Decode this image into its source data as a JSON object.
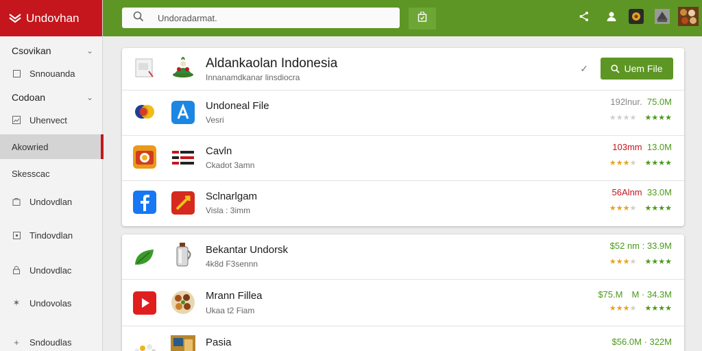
{
  "app": {
    "title": "Undovhan"
  },
  "sidebar": {
    "items": [
      {
        "label": "Csovikan",
        "type": "section"
      },
      {
        "label": "Snnouanda",
        "type": "item",
        "icon": "square-icon"
      },
      {
        "label": "Codoan",
        "type": "section"
      },
      {
        "label": "Uhenvect",
        "type": "item",
        "icon": "chart-icon"
      },
      {
        "label": "Akowried",
        "type": "item",
        "active": true
      },
      {
        "label": "Skesscac",
        "type": "item"
      },
      {
        "label": "Undovdlan",
        "type": "item",
        "icon": "bag-icon"
      },
      {
        "label": "Tindovdlan",
        "type": "item",
        "icon": "square-icon"
      },
      {
        "label": "Undovdlac",
        "type": "item",
        "icon": "lock-icon"
      },
      {
        "label": "Undovolas",
        "type": "item",
        "icon": "star-icon"
      },
      {
        "label": "Sndoudlas",
        "type": "item",
        "icon": "plus-icon"
      }
    ]
  },
  "search": {
    "value": "Undoradarmat."
  },
  "header_card": {
    "title": "Aldankaolan Indonesia",
    "subtitle": "Innanamdkanar linsdiocra",
    "button_label": "Uem File"
  },
  "list1": [
    {
      "title": "Undoneal File",
      "sub": "Vesri",
      "size_a": "192lnur.",
      "size_b": "75.0M",
      "a_color": "gray",
      "stars_a": 0,
      "stars_b": 4
    },
    {
      "title": "Cavln",
      "sub": "Ckadot 3amn",
      "size_a": "103mm",
      "size_b": "13.0M",
      "a_color": "red",
      "stars_a": 3,
      "stars_b": 4
    },
    {
      "title": "Sclnarlgam",
      "sub": "Visla : 3imm",
      "size_a": "56Alnm",
      "size_b": "33.0M",
      "a_color": "red",
      "stars_a": 3,
      "stars_b": 4
    }
  ],
  "list2": [
    {
      "title": "Bekantar Undorsk",
      "sub": "4k8d F3sennn",
      "size_a": "$52 nm :",
      "size_b": "33.9M",
      "a_color": "green",
      "stars_a": 3,
      "stars_b": 4
    },
    {
      "title": "Mrann Fillea",
      "sub": "Ukaa t2 Fiam",
      "size_a": "$75.M　M ·",
      "size_b": "34.3M",
      "a_color": "green",
      "stars_a": 3,
      "stars_b": 4
    },
    {
      "title": "Pasia",
      "sub": "",
      "size_a": "$56.0M ·",
      "size_b": "322M",
      "a_color": "green",
      "stars_a": 0,
      "stars_b": 0
    }
  ],
  "colors": {
    "brand_red": "#c4161c",
    "topbar_green": "#5d9624",
    "rating_green": "#4a9a1a",
    "rating_yellow": "#e8a318"
  }
}
